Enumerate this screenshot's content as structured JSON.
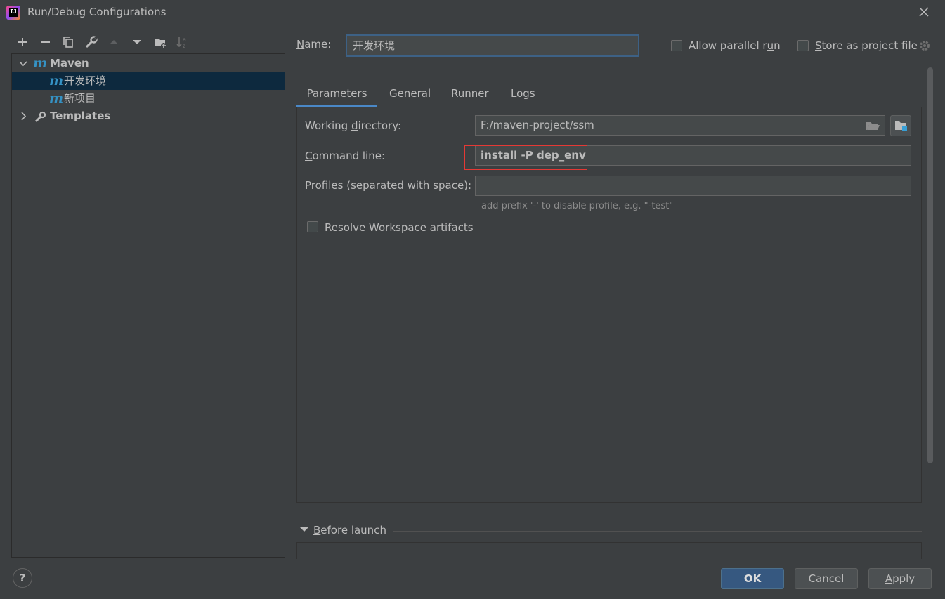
{
  "window": {
    "title": "Run/Debug Configurations",
    "app_icon_text": "IJ"
  },
  "toolbar": {
    "icons": [
      "add-icon",
      "remove-icon",
      "copy-icon",
      "wrench-icon",
      "arrow-up-icon",
      "arrow-down-icon",
      "new-folder-icon",
      "sort-icon"
    ]
  },
  "tree": {
    "maven": {
      "icon": "m",
      "label": "Maven"
    },
    "items": [
      {
        "icon": "m",
        "label": "开发环境",
        "selected": true
      },
      {
        "icon": "m",
        "label": "新项目",
        "selected": false
      }
    ],
    "templates": {
      "label": "Templates"
    }
  },
  "config": {
    "name_label_prefix": "N",
    "name_label_rest": "ame:",
    "name_value": "开发环境",
    "allow_parallel_prefix": "Allow parallel r",
    "allow_parallel_mnemonic": "u",
    "allow_parallel_suffix": "n",
    "store_prefix": "",
    "store_mnemonic": "S",
    "store_suffix": "tore as project file"
  },
  "tabs": [
    {
      "label": "Parameters",
      "active": true
    },
    {
      "label": "General",
      "active": false
    },
    {
      "label": "Runner",
      "active": false
    },
    {
      "label": "Logs",
      "active": false
    }
  ],
  "parameters": {
    "working_dir_prefix": "Working ",
    "working_dir_mnemonic": "d",
    "working_dir_suffix": "irectory:",
    "working_dir_value": "F:/maven-project/ssm",
    "command_mnemonic": "C",
    "command_suffix": "ommand line:",
    "command_value": "install -P dep_env",
    "profiles_mnemonic": "P",
    "profiles_suffix": "rofiles (separated with space):",
    "profiles_value": "",
    "profiles_hint": "add prefix '-' to disable profile, e.g. \"-test\"",
    "resolve_prefix": "Resolve ",
    "resolve_mnemonic": "W",
    "resolve_suffix": "orkspace artifacts"
  },
  "before_launch": {
    "mnemonic": "B",
    "suffix": "efore launch"
  },
  "buttons": {
    "help": "?",
    "ok": "OK",
    "cancel": "Cancel",
    "apply_mnemonic": "A",
    "apply_suffix": "pply"
  },
  "colors": {
    "background": "#3c3f41",
    "selection": "#0d293e",
    "accent": "#4a88c7",
    "maven_icon": "#3592c4",
    "primary_button": "#365880",
    "highlight_box": "#e53935"
  }
}
